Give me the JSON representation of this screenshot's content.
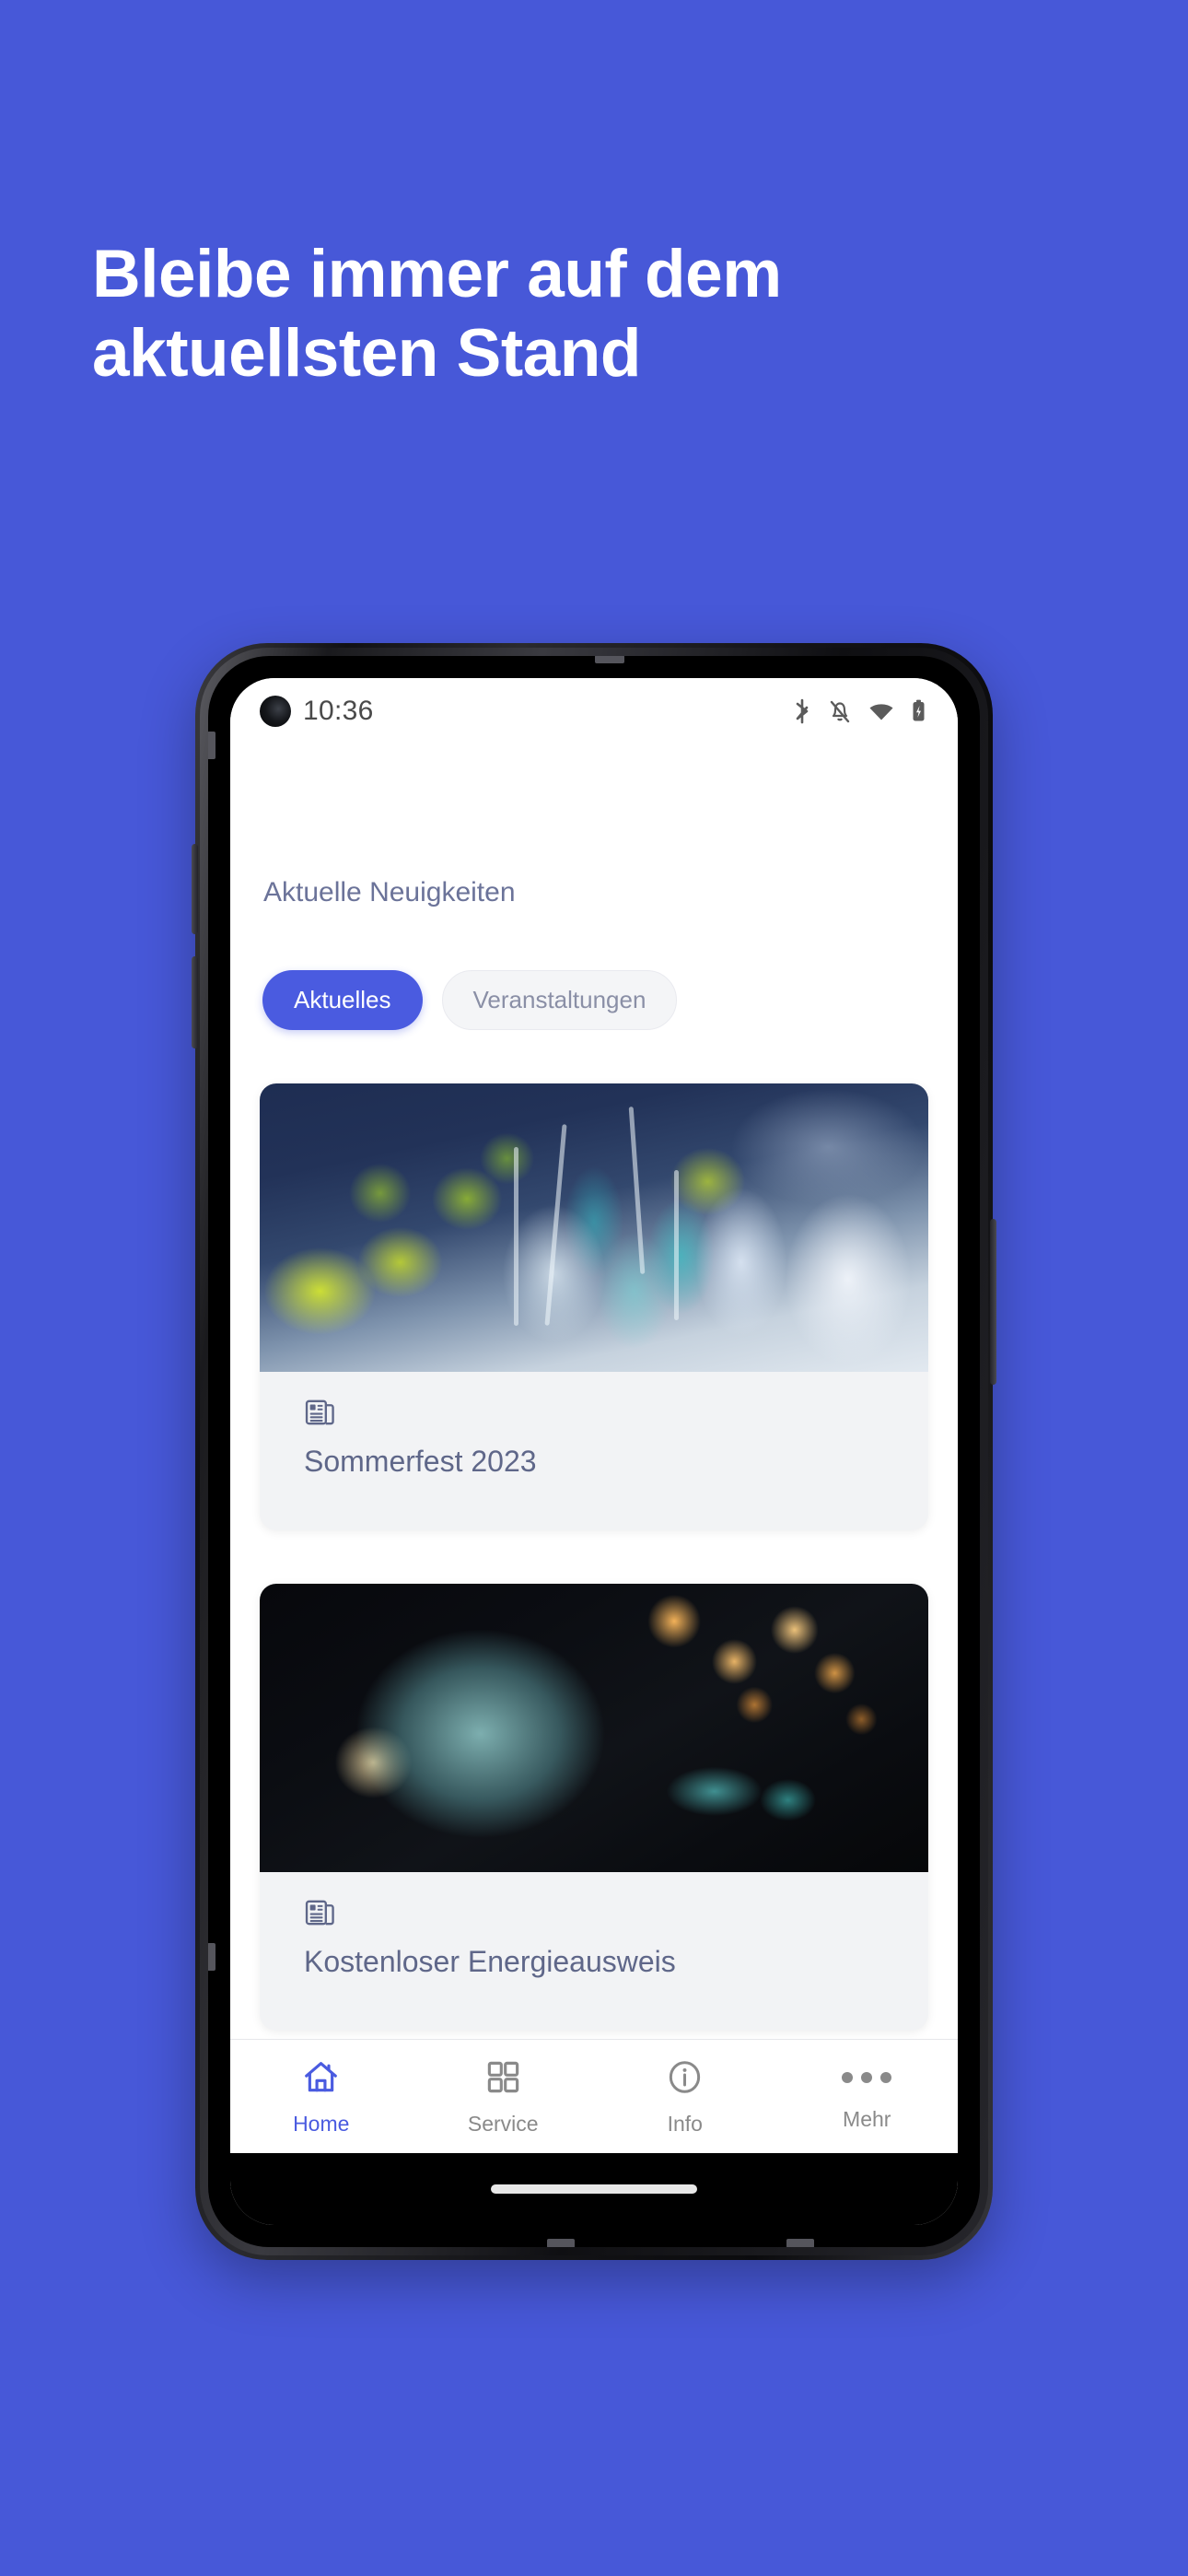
{
  "page": {
    "background_color": "#4758D8",
    "headline_line1": "Bleibe immer auf dem",
    "headline_line2": "aktuellsten Stand"
  },
  "phone": {
    "status_bar": {
      "time": "10:36",
      "icons": [
        "bluetooth-icon",
        "notifications-off-icon",
        "wifi-icon",
        "battery-charging-icon"
      ]
    },
    "home_indicator": "gesture-bar"
  },
  "app": {
    "section_title": "Aktuelle Neuigkeiten",
    "accent_color": "#4A5BE0",
    "text_color": "#6B7399",
    "tabs": [
      {
        "label": "Aktuelles",
        "active": true
      },
      {
        "label": "Veranstaltungen",
        "active": false
      }
    ],
    "cards": [
      {
        "title": "Sommerfest 2023",
        "icon": "newspaper-icon",
        "image_description": "Festlich gedeckter Tisch mit Sektgläsern, gelbgrünen Blumen und türkisen Vasen"
      },
      {
        "title": "Kostenloser Energieausweis",
        "icon": "newspaper-icon",
        "image_description": "Glühbirne in Türkistönen vor orangefarbenen Bokeh-Lichtern"
      }
    ],
    "bottom_nav": [
      {
        "label": "Home",
        "icon": "home-icon",
        "active": true
      },
      {
        "label": "Service",
        "icon": "grid-icon",
        "active": false
      },
      {
        "label": "Info",
        "icon": "info-icon",
        "active": false
      },
      {
        "label": "Mehr",
        "icon": "ellipsis-icon",
        "active": false
      }
    ]
  }
}
